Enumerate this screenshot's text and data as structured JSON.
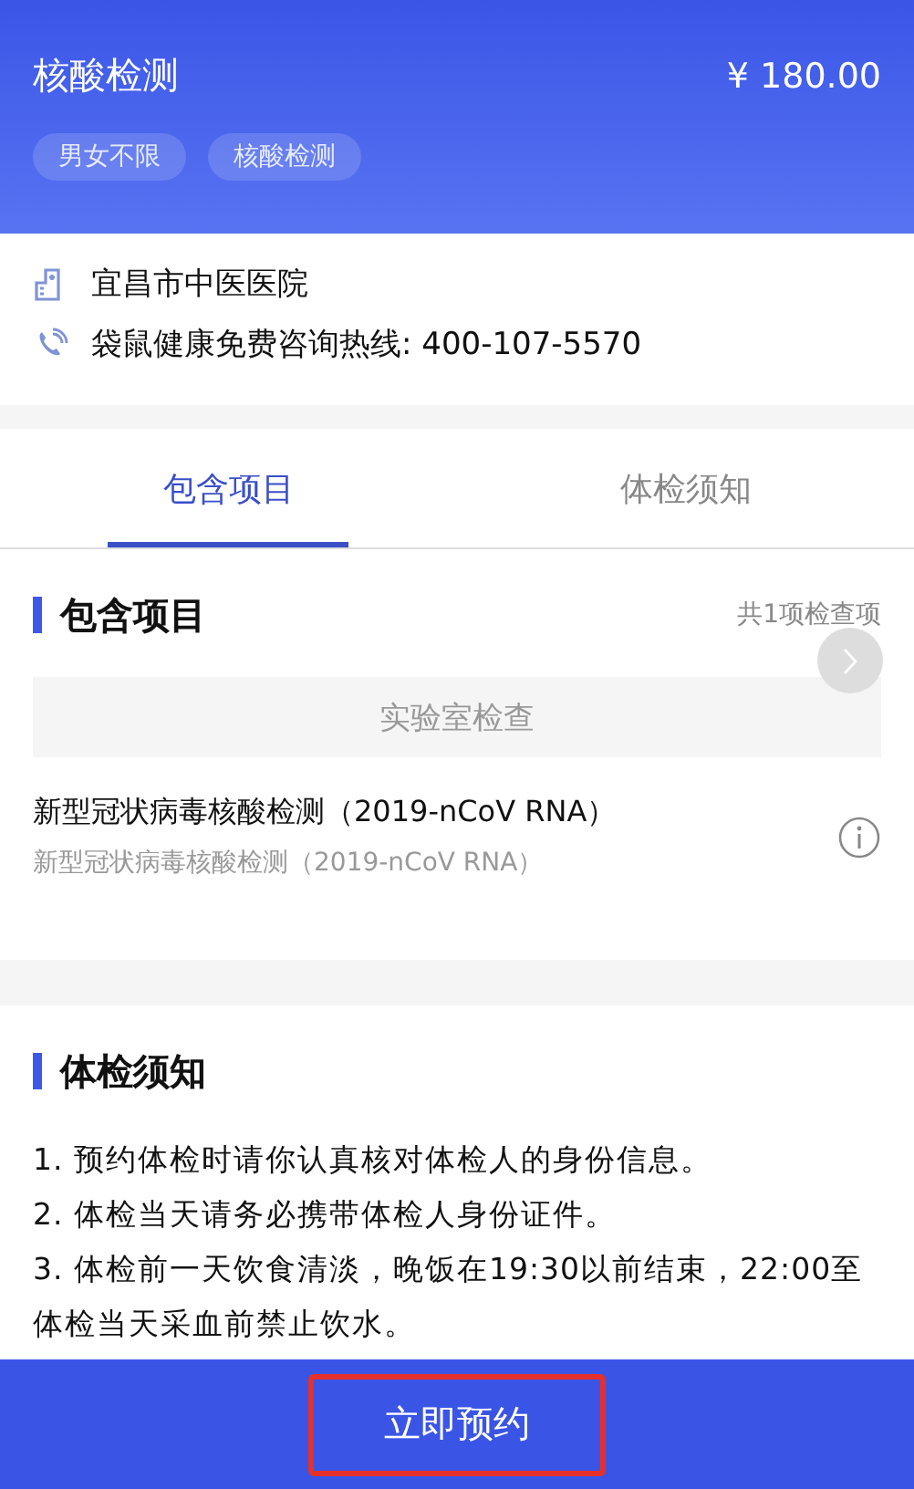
{
  "header": {
    "title": "核酸检测",
    "price": "¥ 180.00",
    "tags": [
      "男女不限",
      "核酸检测"
    ]
  },
  "info": {
    "hospital": "宜昌市中医医院",
    "hotline": "袋鼠健康免费咨询热线: 400-107-5570"
  },
  "tabs": [
    {
      "label": "包含项目",
      "selected": true
    },
    {
      "label": "体检须知",
      "selected": false
    }
  ],
  "items_section": {
    "title": "包含项目",
    "count": "共1项检查项",
    "category": "实验室检查",
    "items": [
      {
        "name": "新型冠状病毒核酸检测（2019-nCoV RNA）",
        "subtitle": "新型冠状病毒核酸检测（2019-nCoV RNA）"
      }
    ]
  },
  "notice_section": {
    "title": "体检须知",
    "lines": [
      "1. 预约体检时请你认真核对体检人的身份信息。",
      "2. 体检当天请务必携带体检人身份证件。",
      "3. 体检前一天饮食清淡，晚饭在19:30以前结束，22:00至体检当天采血前禁止饮水。"
    ]
  },
  "book_button": {
    "label": "立即预约",
    "highlighted": true
  }
}
